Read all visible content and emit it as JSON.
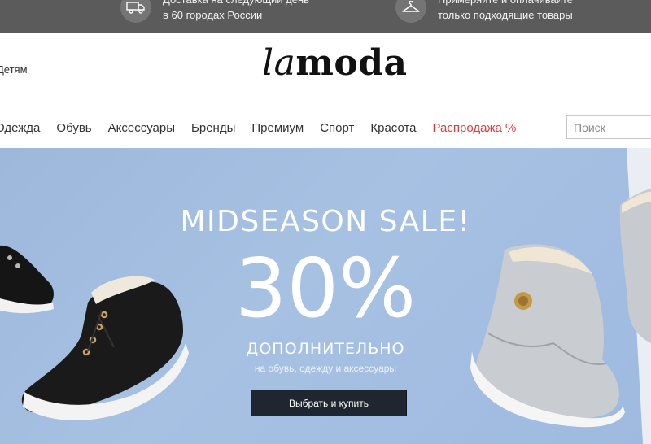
{
  "topbar": {
    "delivery": {
      "icon": "truck-icon",
      "line1": "Доставка на следующий день",
      "line2": "в 60 городах России"
    },
    "fitting": {
      "icon": "hanger-icon",
      "line1": "Примеряйте и оплачивайте",
      "line2": "только подходящие товары"
    }
  },
  "header": {
    "kids_link": "Детям",
    "logo_la": "la",
    "logo_moda": "moda"
  },
  "nav": {
    "items": [
      "Одежда",
      "Обувь",
      "Аксессуары",
      "Бренды",
      "Премиум",
      "Спорт",
      "Красота",
      "Распродажа %"
    ],
    "sale_color": "#e03a3e"
  },
  "search": {
    "placeholder": "Поиск",
    "value": ""
  },
  "banner": {
    "headline": "MIDSEASON SALE!",
    "percent": "30%",
    "extra": "ДОПОЛНИТЕЛЬНО",
    "subtitle": "на обувь, одежду и аксессуары",
    "cta": "Выбрать и купить",
    "background": "#a4bfe2"
  }
}
